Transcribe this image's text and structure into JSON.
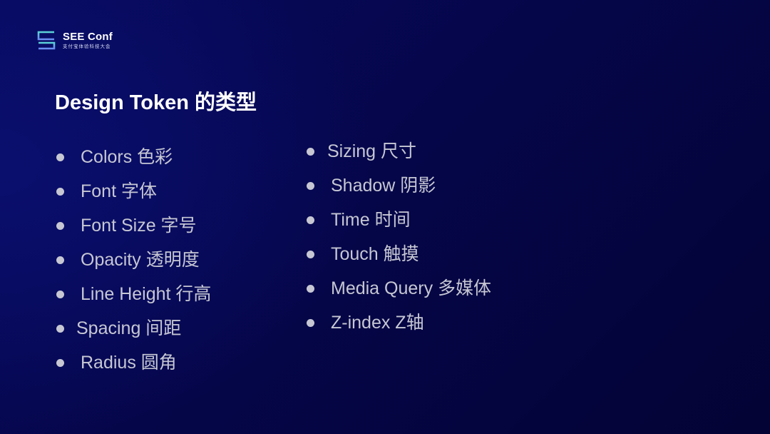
{
  "brand": {
    "name": "SEE Conf",
    "subtitle": "支付宝体验科技大会",
    "logo_icon": "see-logo-icon",
    "logo_colors": {
      "top": "#5ad2d6",
      "bottom": "#6b8cf2"
    }
  },
  "slide": {
    "title": "Design Token 的类型",
    "background": {
      "start": "#0a0f6e",
      "end": "#040335"
    },
    "text_color": "#c6c7d3"
  },
  "list_left": [
    {
      "label": "Colors 色彩"
    },
    {
      "label": "Font 字体"
    },
    {
      "label": "Font Size 字号"
    },
    {
      "label": "Opacity 透明度"
    },
    {
      "label": "Line Height 行高"
    },
    {
      "label": "Spacing 间距"
    },
    {
      "label": "Radius 圆角"
    }
  ],
  "list_right": [
    {
      "label": "Sizing 尺寸"
    },
    {
      "label": "Shadow 阴影"
    },
    {
      "label": "Time 时间"
    },
    {
      "label": "Touch 触摸"
    },
    {
      "label": "Media Query 多媒体"
    },
    {
      "label": "Z-index Z轴"
    }
  ]
}
